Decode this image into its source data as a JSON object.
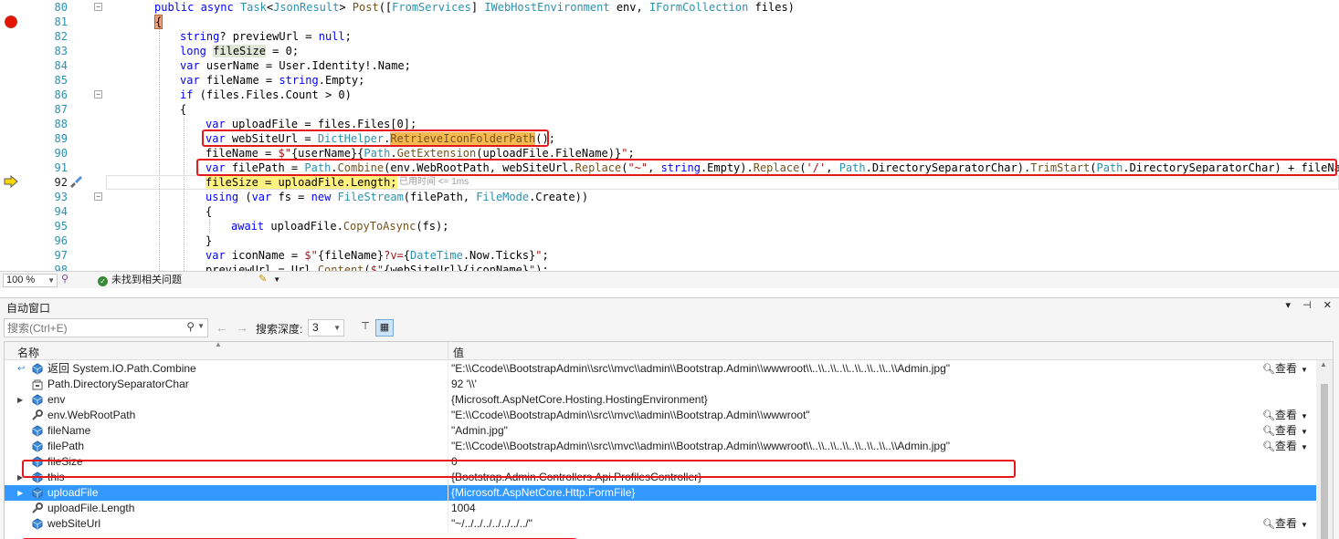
{
  "editor": {
    "lines": [
      {
        "num": "80"
      },
      {
        "num": "81"
      },
      {
        "num": "82"
      },
      {
        "num": "83"
      },
      {
        "num": "84"
      },
      {
        "num": "85"
      },
      {
        "num": "86"
      },
      {
        "num": "87"
      },
      {
        "num": "88"
      },
      {
        "num": "89"
      },
      {
        "num": "90"
      },
      {
        "num": "91"
      },
      {
        "num": "92"
      },
      {
        "num": "93"
      },
      {
        "num": "94"
      },
      {
        "num": "95"
      },
      {
        "num": "96"
      },
      {
        "num": "97"
      },
      {
        "num": "98"
      }
    ],
    "elapsed_hint": "已用时间 <= 1ms",
    "breakpoint_color": "#e51400",
    "highlight_box_color": "#e51919"
  },
  "status_bar": {
    "zoom": "100 %",
    "issues": "未找到相关问题"
  },
  "autos": {
    "title": "自动窗口",
    "search_placeholder": "搜索(Ctrl+E)",
    "depth_label": "搜索深度:",
    "depth_value": "3",
    "columns": {
      "name": "名称",
      "value": "值"
    },
    "view_label": "查看",
    "rows": [
      {
        "name": "返回 System.IO.Path.Combine",
        "value": "\"E:\\\\Ccode\\\\BootstrapAdmin\\\\src\\\\mvc\\\\admin\\\\Bootstrap.Admin\\\\wwwroot\\\\..\\\\..\\\\..\\\\..\\\\..\\\\..\\\\..\\\\Admin.jpg\"",
        "icon": "return-value-icon",
        "has_view": true,
        "expandable": false
      },
      {
        "name": "Path.DirectorySeparatorChar",
        "value": "92 '\\\\'",
        "icon": "static-field-icon",
        "has_view": false,
        "expandable": false
      },
      {
        "name": "env",
        "value": "{Microsoft.AspNetCore.Hosting.HostingEnvironment}",
        "icon": "variable-icon",
        "has_view": false,
        "expandable": true
      },
      {
        "name": "env.WebRootPath",
        "value": "\"E:\\\\Ccode\\\\BootstrapAdmin\\\\src\\\\mvc\\\\admin\\\\Bootstrap.Admin\\\\wwwroot\"",
        "icon": "property-icon",
        "has_view": true,
        "expandable": false
      },
      {
        "name": "fileName",
        "value": "\"Admin.jpg\"",
        "icon": "variable-icon",
        "has_view": true,
        "expandable": false
      },
      {
        "name": "filePath",
        "value": "\"E:\\\\Ccode\\\\BootstrapAdmin\\\\src\\\\mvc\\\\admin\\\\Bootstrap.Admin\\\\wwwroot\\\\..\\\\..\\\\..\\\\..\\\\..\\\\..\\\\..\\\\Admin.jpg\"",
        "icon": "variable-icon",
        "has_view": true,
        "expandable": false
      },
      {
        "name": "fileSize",
        "value": "0",
        "icon": "variable-icon",
        "has_view": false,
        "expandable": false
      },
      {
        "name": "this",
        "value": "{Bootstrap.Admin.Controllers.Api.ProfilesController}",
        "icon": "variable-icon",
        "has_view": false,
        "expandable": true
      },
      {
        "name": "uploadFile",
        "value": "{Microsoft.AspNetCore.Http.FormFile}",
        "icon": "variable-icon",
        "has_view": false,
        "expandable": true
      },
      {
        "name": "uploadFile.Length",
        "value": "1004",
        "icon": "property-icon",
        "has_view": false,
        "expandable": false
      },
      {
        "name": "webSiteUrl",
        "value": "\"~/../../../../../../../\"",
        "icon": "variable-icon",
        "has_view": true,
        "expandable": false
      }
    ]
  }
}
